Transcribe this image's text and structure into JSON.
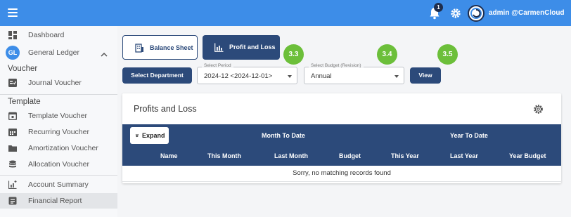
{
  "topbar": {
    "notification_count": "1",
    "user_label": "admin @CarmenCloud",
    "color": "#3d8de8"
  },
  "sidebar": {
    "items": [
      {
        "label": "Dashboard",
        "icon": "dashboard-icon"
      },
      {
        "label": "General Ledger",
        "badge": "GL",
        "icon": "chevron-up-icon"
      },
      {
        "label": "Journal Voucher",
        "icon": "journal-voucher-icon"
      },
      {
        "label": "Template Voucher",
        "icon": "calendar-icon"
      },
      {
        "label": "Recurring Voucher",
        "icon": "calendar-grid-icon"
      },
      {
        "label": "Amortization Voucher",
        "icon": "folder-icon"
      },
      {
        "label": "Allocation Voucher",
        "icon": "database-icon"
      },
      {
        "label": "Account Summary",
        "icon": "chart-icon"
      },
      {
        "label": "Financial Report",
        "icon": "report-icon"
      }
    ],
    "sections": {
      "voucher": "Voucher",
      "template": "Template"
    }
  },
  "tabs": {
    "balance_sheet": "Balance Sheet",
    "profit_and_loss": "Profit and Loss"
  },
  "steps": [
    "3.3",
    "3.4",
    "3.5"
  ],
  "filters": {
    "department_button": "Select Department",
    "period": {
      "legend": "Select Period",
      "value": "2024-12 <2024-12-01>"
    },
    "budget": {
      "legend": "Select Budget (Revision)",
      "value": "Annual"
    },
    "view_button": "View"
  },
  "report": {
    "title": "Profits and Loss",
    "expand_label": "Expand",
    "expand_icon": "»",
    "groups": {
      "month_to_date": "Month To Date",
      "year_to_date": "Year To Date"
    },
    "columns": [
      "Name",
      "This Month",
      "Last Month",
      "Budget",
      "This Year",
      "Last Year",
      "Year Budget"
    ],
    "empty_message": "Sorry, no matching records found"
  },
  "colors": {
    "primary_dark": "#2c4a7a",
    "step_badge": "#6cbf3a"
  }
}
